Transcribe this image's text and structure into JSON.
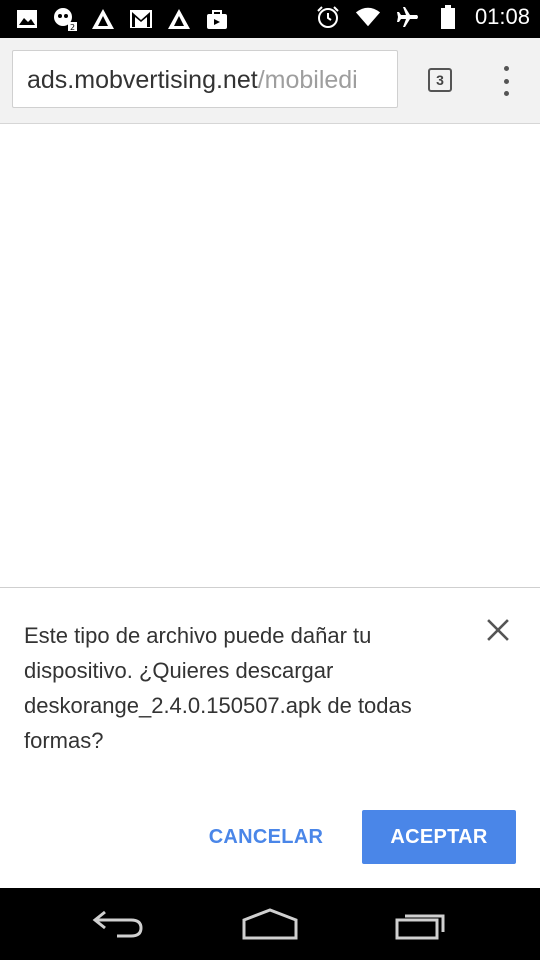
{
  "status_bar": {
    "time": "01:08",
    "left_icons": [
      "image-icon",
      "face-notification-icon",
      "alert-triangle-icon",
      "gmail-icon",
      "alert-triangle-icon",
      "shopping-bag-icon"
    ],
    "right_icons": [
      "alarm-icon",
      "wifi-icon",
      "airplane-icon",
      "battery-icon"
    ]
  },
  "toolbar": {
    "url_domain": "ads.mobvertising.net",
    "url_path": "/mobiledi",
    "tab_count": "3",
    "menu_icon": "overflow-menu-icon"
  },
  "infobar": {
    "message": "Este tipo de archivo puede dañar tu dispositivo. ¿Quieres descargar deskorange_2.4.0.150507.apk de todas formas?",
    "cancel_label": "CANCELAR",
    "accept_label": "ACEPTAR",
    "close_icon": "close-icon"
  },
  "nav_bar": {
    "icons": [
      "back-icon",
      "home-icon",
      "recents-icon"
    ]
  },
  "colors": {
    "accent": "#4a86e8",
    "status_bar": "#000000",
    "toolbar": "#f2f2f2"
  }
}
